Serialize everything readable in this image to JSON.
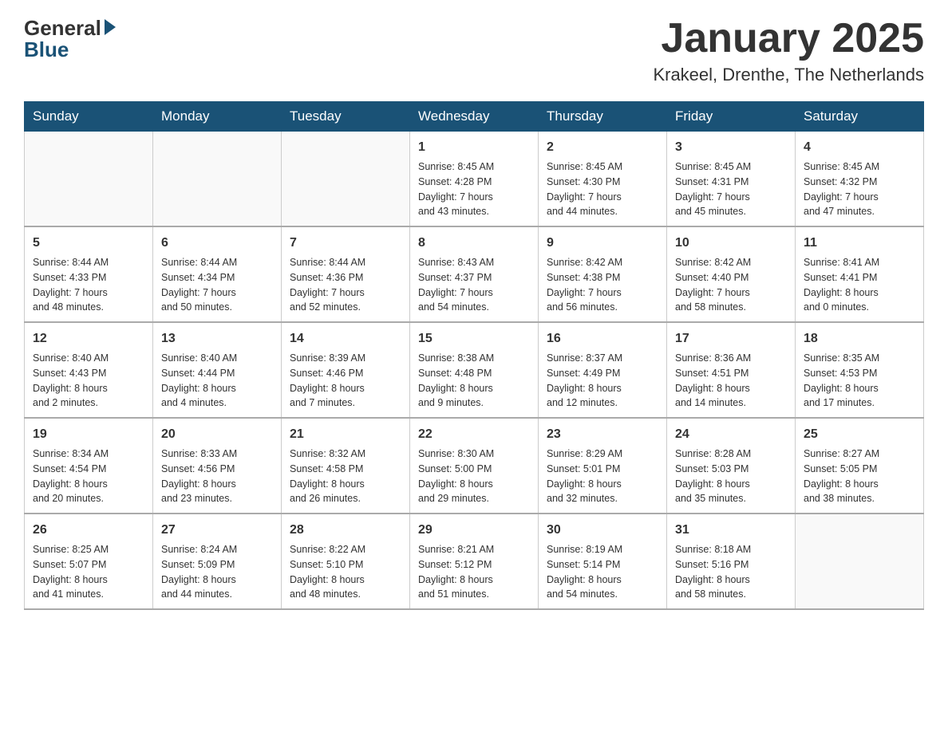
{
  "header": {
    "logo_general": "General",
    "logo_blue": "Blue",
    "month_title": "January 2025",
    "location": "Krakeel, Drenthe, The Netherlands"
  },
  "weekdays": [
    "Sunday",
    "Monday",
    "Tuesday",
    "Wednesday",
    "Thursday",
    "Friday",
    "Saturday"
  ],
  "weeks": [
    [
      {
        "day": "",
        "info": ""
      },
      {
        "day": "",
        "info": ""
      },
      {
        "day": "",
        "info": ""
      },
      {
        "day": "1",
        "info": "Sunrise: 8:45 AM\nSunset: 4:28 PM\nDaylight: 7 hours\nand 43 minutes."
      },
      {
        "day": "2",
        "info": "Sunrise: 8:45 AM\nSunset: 4:30 PM\nDaylight: 7 hours\nand 44 minutes."
      },
      {
        "day": "3",
        "info": "Sunrise: 8:45 AM\nSunset: 4:31 PM\nDaylight: 7 hours\nand 45 minutes."
      },
      {
        "day": "4",
        "info": "Sunrise: 8:45 AM\nSunset: 4:32 PM\nDaylight: 7 hours\nand 47 minutes."
      }
    ],
    [
      {
        "day": "5",
        "info": "Sunrise: 8:44 AM\nSunset: 4:33 PM\nDaylight: 7 hours\nand 48 minutes."
      },
      {
        "day": "6",
        "info": "Sunrise: 8:44 AM\nSunset: 4:34 PM\nDaylight: 7 hours\nand 50 minutes."
      },
      {
        "day": "7",
        "info": "Sunrise: 8:44 AM\nSunset: 4:36 PM\nDaylight: 7 hours\nand 52 minutes."
      },
      {
        "day": "8",
        "info": "Sunrise: 8:43 AM\nSunset: 4:37 PM\nDaylight: 7 hours\nand 54 minutes."
      },
      {
        "day": "9",
        "info": "Sunrise: 8:42 AM\nSunset: 4:38 PM\nDaylight: 7 hours\nand 56 minutes."
      },
      {
        "day": "10",
        "info": "Sunrise: 8:42 AM\nSunset: 4:40 PM\nDaylight: 7 hours\nand 58 minutes."
      },
      {
        "day": "11",
        "info": "Sunrise: 8:41 AM\nSunset: 4:41 PM\nDaylight: 8 hours\nand 0 minutes."
      }
    ],
    [
      {
        "day": "12",
        "info": "Sunrise: 8:40 AM\nSunset: 4:43 PM\nDaylight: 8 hours\nand 2 minutes."
      },
      {
        "day": "13",
        "info": "Sunrise: 8:40 AM\nSunset: 4:44 PM\nDaylight: 8 hours\nand 4 minutes."
      },
      {
        "day": "14",
        "info": "Sunrise: 8:39 AM\nSunset: 4:46 PM\nDaylight: 8 hours\nand 7 minutes."
      },
      {
        "day": "15",
        "info": "Sunrise: 8:38 AM\nSunset: 4:48 PM\nDaylight: 8 hours\nand 9 minutes."
      },
      {
        "day": "16",
        "info": "Sunrise: 8:37 AM\nSunset: 4:49 PM\nDaylight: 8 hours\nand 12 minutes."
      },
      {
        "day": "17",
        "info": "Sunrise: 8:36 AM\nSunset: 4:51 PM\nDaylight: 8 hours\nand 14 minutes."
      },
      {
        "day": "18",
        "info": "Sunrise: 8:35 AM\nSunset: 4:53 PM\nDaylight: 8 hours\nand 17 minutes."
      }
    ],
    [
      {
        "day": "19",
        "info": "Sunrise: 8:34 AM\nSunset: 4:54 PM\nDaylight: 8 hours\nand 20 minutes."
      },
      {
        "day": "20",
        "info": "Sunrise: 8:33 AM\nSunset: 4:56 PM\nDaylight: 8 hours\nand 23 minutes."
      },
      {
        "day": "21",
        "info": "Sunrise: 8:32 AM\nSunset: 4:58 PM\nDaylight: 8 hours\nand 26 minutes."
      },
      {
        "day": "22",
        "info": "Sunrise: 8:30 AM\nSunset: 5:00 PM\nDaylight: 8 hours\nand 29 minutes."
      },
      {
        "day": "23",
        "info": "Sunrise: 8:29 AM\nSunset: 5:01 PM\nDaylight: 8 hours\nand 32 minutes."
      },
      {
        "day": "24",
        "info": "Sunrise: 8:28 AM\nSunset: 5:03 PM\nDaylight: 8 hours\nand 35 minutes."
      },
      {
        "day": "25",
        "info": "Sunrise: 8:27 AM\nSunset: 5:05 PM\nDaylight: 8 hours\nand 38 minutes."
      }
    ],
    [
      {
        "day": "26",
        "info": "Sunrise: 8:25 AM\nSunset: 5:07 PM\nDaylight: 8 hours\nand 41 minutes."
      },
      {
        "day": "27",
        "info": "Sunrise: 8:24 AM\nSunset: 5:09 PM\nDaylight: 8 hours\nand 44 minutes."
      },
      {
        "day": "28",
        "info": "Sunrise: 8:22 AM\nSunset: 5:10 PM\nDaylight: 8 hours\nand 48 minutes."
      },
      {
        "day": "29",
        "info": "Sunrise: 8:21 AM\nSunset: 5:12 PM\nDaylight: 8 hours\nand 51 minutes."
      },
      {
        "day": "30",
        "info": "Sunrise: 8:19 AM\nSunset: 5:14 PM\nDaylight: 8 hours\nand 54 minutes."
      },
      {
        "day": "31",
        "info": "Sunrise: 8:18 AM\nSunset: 5:16 PM\nDaylight: 8 hours\nand 58 minutes."
      },
      {
        "day": "",
        "info": ""
      }
    ]
  ]
}
